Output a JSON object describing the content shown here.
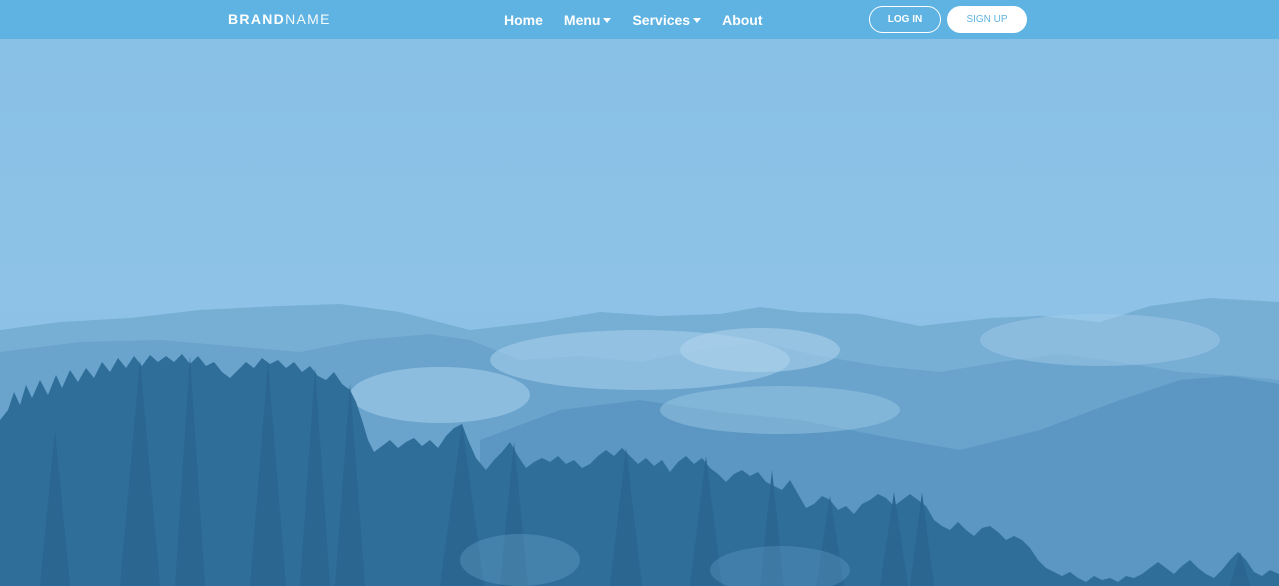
{
  "brand": {
    "bold": "BRAND",
    "light": "NAME"
  },
  "nav": {
    "home": "Home",
    "menu": "Menu",
    "services": "Services",
    "about": "About"
  },
  "auth": {
    "login": "LOG IN",
    "signup": "SIGN UP"
  },
  "hero": {
    "image": "misty blue mountain landscape with pine forest"
  },
  "colors": {
    "navbar": "#5fb3e2",
    "sky": "#8cc1e6",
    "forest": "#2f6e99"
  }
}
